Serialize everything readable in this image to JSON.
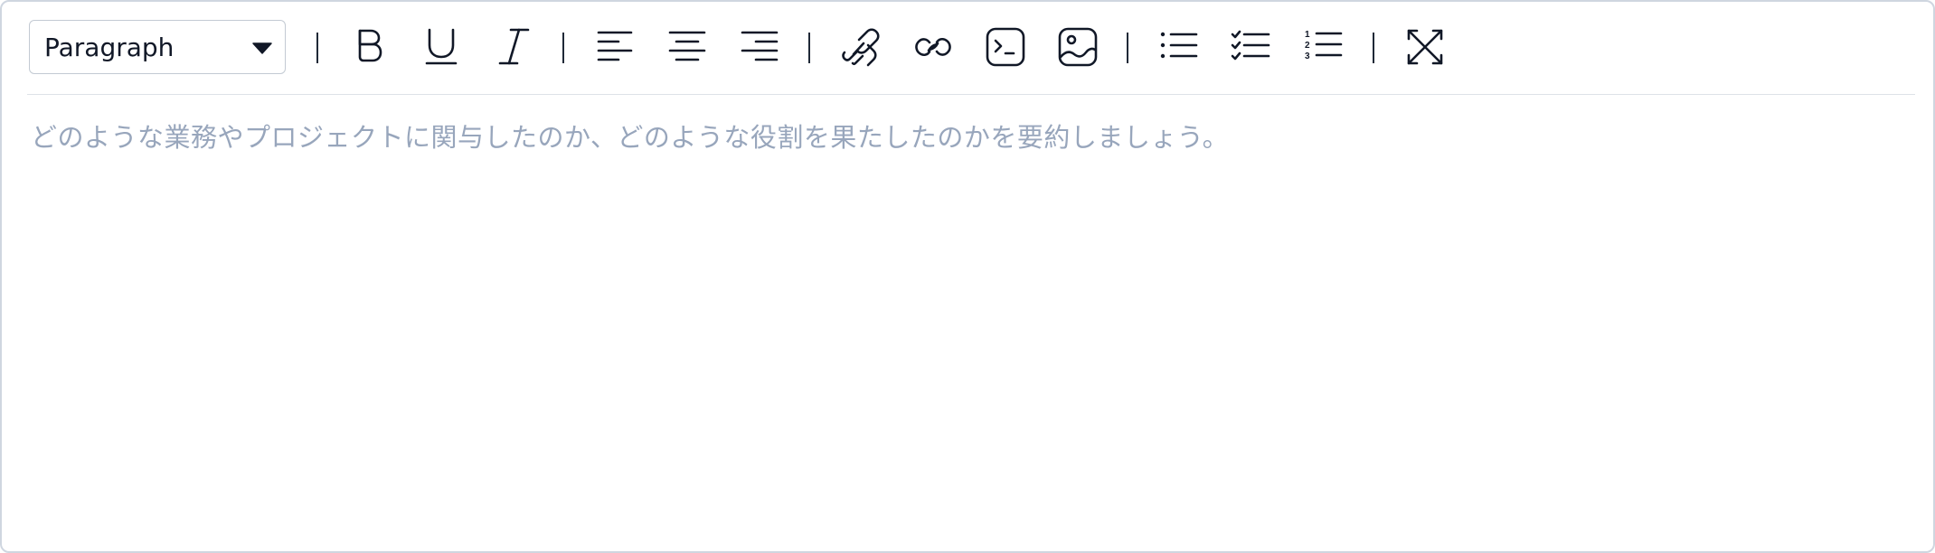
{
  "toolbar": {
    "format_select": {
      "value": "Paragraph"
    },
    "buttons": [
      {
        "name": "bold-button",
        "icon": "bold-icon"
      },
      {
        "name": "underline-button",
        "icon": "underline-icon"
      },
      {
        "name": "italic-button",
        "icon": "italic-icon"
      },
      {
        "name": "align-left-button",
        "icon": "align-left-icon"
      },
      {
        "name": "align-center-button",
        "icon": "align-center-icon"
      },
      {
        "name": "align-right-button",
        "icon": "align-right-icon"
      },
      {
        "name": "link-button",
        "icon": "paperclip-link-icon"
      },
      {
        "name": "unlink-button",
        "icon": "chain-link-icon"
      },
      {
        "name": "code-block-button",
        "icon": "terminal-icon"
      },
      {
        "name": "image-button",
        "icon": "image-icon"
      },
      {
        "name": "bullet-list-button",
        "icon": "bullet-list-icon"
      },
      {
        "name": "checklist-button",
        "icon": "checklist-icon"
      },
      {
        "name": "numbered-list-button",
        "icon": "numbered-list-icon"
      },
      {
        "name": "fullscreen-button",
        "icon": "expand-icon"
      }
    ],
    "numbered_list_digits": [
      "1",
      "2",
      "3"
    ]
  },
  "editor": {
    "placeholder": "どのような業務やプロジェクトに関与したのか、どのような役割を果たしたのかを要約しましょう。",
    "value": ""
  },
  "colors": {
    "border": "#cfd6e0",
    "icon": "#111827",
    "placeholder": "#98a6bc",
    "divider": "#dde2e8"
  }
}
